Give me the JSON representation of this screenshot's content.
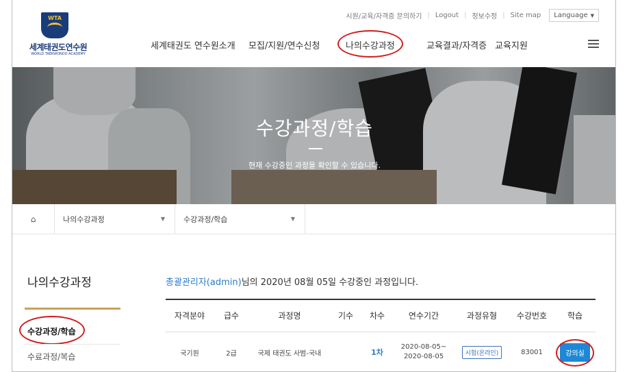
{
  "util": {
    "link1": "시원/교육/자격증 문의하기",
    "logout": "Logout",
    "profile": "정보수정",
    "sitemap": "Site map",
    "language": "Language"
  },
  "logo": {
    "badge": "WTA",
    "name": "세계태권도연수원",
    "sub": "WORLD TAEKWONDO ACADEMY"
  },
  "nav": {
    "items": [
      {
        "label": "세계태권도 연수원소개"
      },
      {
        "label": "모집/지원/연수신청"
      },
      {
        "label": "나의수강과정"
      },
      {
        "label": "교육결과/자격증"
      },
      {
        "label": "교육지원"
      }
    ]
  },
  "hero": {
    "title": "수강과정/학습",
    "subtitle": "현재 수강중인 과정을 확인할 수 있습니다."
  },
  "breadcrumb": {
    "level1": "나의수강과정",
    "level2": "수강과정/학습"
  },
  "sidebar": {
    "title": "나의수강과정",
    "items": [
      {
        "label": "수강과정/학습"
      },
      {
        "label": "수료과정/복습"
      }
    ]
  },
  "main": {
    "greeting_user": "총괄관리자(admin)",
    "greeting_rest": "님의 2020년 08월 05일 수강중인 과정입니다.",
    "columns": [
      "자격분야",
      "급수",
      "과정명",
      "기수",
      "차수",
      "연수기간",
      "과정유형",
      "수강번호",
      "학습"
    ],
    "rows": [
      {
        "field": "국기원",
        "grade": "2급",
        "course": "국제 태권도 사범-국내",
        "term": "",
        "round": "1차",
        "period_start": "2020-08-05~",
        "period_end": "2020-08-05",
        "type": "시험(온라인)",
        "number": "83001",
        "action": "강의실"
      }
    ]
  },
  "colors": {
    "brand_navy": "#1b3c7a",
    "accent_blue": "#2a7cc7",
    "button_blue": "#1e88d6",
    "annotation_red": "#d11c1c",
    "sidebar_gold": "#c8a25a"
  }
}
